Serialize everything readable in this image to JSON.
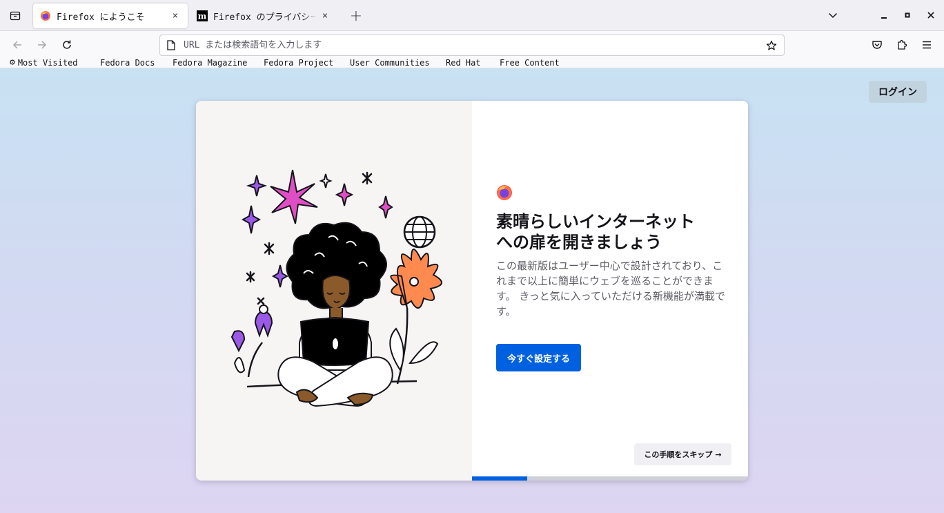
{
  "tabs": [
    {
      "title": "Firefox にようこそ",
      "active": true,
      "favicon": "firefox-logo-icon",
      "close": "×"
    },
    {
      "title": "Firefox のプライバシーに関する通知",
      "active": false,
      "favicon": "mozilla-m-icon",
      "close": "×"
    }
  ],
  "tabstrip": {
    "new_tab": "+"
  },
  "urlbar": {
    "placeholder": "URL または検索語句を入力します",
    "value": ""
  },
  "bookmarks": [
    "Most Visited",
    "Fedora Docs",
    "Fedora Magazine",
    "Fedora Project",
    "User Communities",
    "Red Hat",
    "Free Content"
  ],
  "content": {
    "login_label": "ログイン",
    "headline_line1": "素晴らしいインターネット",
    "headline_line2": "への扉を開きましょう",
    "subtitle": "この最新版はユーザー中心で設計されており、これまで以上に簡単にウェブを巡ることができます。 きっと気に入っていただける新機能が満載です。",
    "primary_button": "今すぐ設定する",
    "skip_button": "この手順をスキップ",
    "skip_arrow": "→",
    "progress": 0.2
  },
  "colors": {
    "accent": "#0061e0",
    "login_bg": "#c2d3e0",
    "bg_top": "#c8e1f3",
    "bg_bottom": "#ddd5f2"
  }
}
